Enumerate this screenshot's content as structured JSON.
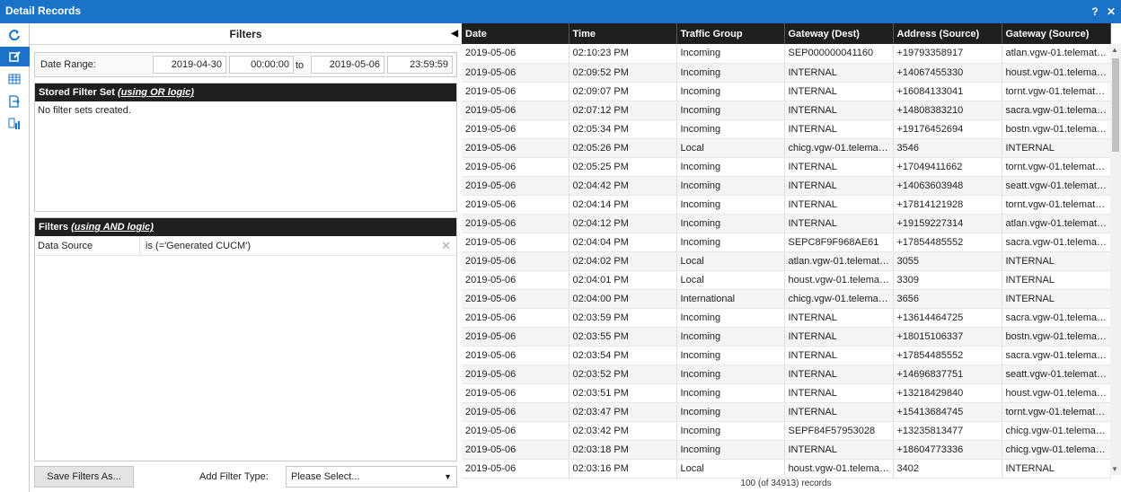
{
  "window": {
    "title": "Detail Records",
    "help": "?",
    "close": "✕"
  },
  "toolbar": {
    "icons": [
      "refresh-icon",
      "edit-icon",
      "table-icon",
      "export-icon",
      "report-icon"
    ]
  },
  "filters": {
    "title": "Filters",
    "date_range_label": "Date Range:",
    "start_date": "2019-04-30",
    "start_time": "00:00:00",
    "to_label": "to",
    "end_date": "2019-05-06",
    "end_time": "23:59:59",
    "stored_set_title": "Stored Filter Set",
    "stored_set_logic": "(using OR logic)",
    "stored_set_empty": "No filter sets created.",
    "filters_title": "Filters",
    "filters_logic": "(using AND logic)",
    "rows": [
      {
        "field": "Data Source",
        "condition": "is (='Generated CUCM')"
      }
    ],
    "save_button": "Save Filters As...",
    "add_filter_label": "Add Filter Type:",
    "add_filter_select": "Please Select..."
  },
  "grid": {
    "columns": [
      "Date",
      "Time",
      "Traffic Group",
      "Gateway (Dest)",
      "Address (Source)",
      "Gateway (Source)"
    ],
    "rows": [
      [
        "2019-05-06",
        "02:10:23 PM",
        "Incoming",
        "SEP000000041160",
        "+19793358917",
        "atlan.vgw-01.telemat…"
      ],
      [
        "2019-05-06",
        "02:09:52 PM",
        "Incoming",
        "INTERNAL",
        "+14067455330",
        "houst.vgw-01.telema…"
      ],
      [
        "2019-05-06",
        "02:09:07 PM",
        "Incoming",
        "INTERNAL",
        "+16084133041",
        "tornt.vgw-01.telemat…"
      ],
      [
        "2019-05-06",
        "02:07:12 PM",
        "Incoming",
        "INTERNAL",
        "+14808383210",
        "sacra.vgw-01.telema…"
      ],
      [
        "2019-05-06",
        "02:05:34 PM",
        "Incoming",
        "INTERNAL",
        "+19176452694",
        "bostn.vgw-01.telema…"
      ],
      [
        "2019-05-06",
        "02:05:26 PM",
        "Local",
        "chicg.vgw-01.telema…",
        "3546",
        "INTERNAL"
      ],
      [
        "2019-05-06",
        "02:05:25 PM",
        "Incoming",
        "INTERNAL",
        "+17049411662",
        "tornt.vgw-01.telemat…"
      ],
      [
        "2019-05-06",
        "02:04:42 PM",
        "Incoming",
        "INTERNAL",
        "+14063603948",
        "seatt.vgw-01.telemat…"
      ],
      [
        "2019-05-06",
        "02:04:14 PM",
        "Incoming",
        "INTERNAL",
        "+17814121928",
        "tornt.vgw-01.telemat…"
      ],
      [
        "2019-05-06",
        "02:04:12 PM",
        "Incoming",
        "INTERNAL",
        "+19159227314",
        "atlan.vgw-01.telemat…"
      ],
      [
        "2019-05-06",
        "02:04:04 PM",
        "Incoming",
        "SEPC8F9F968AE61",
        "+17854485552",
        "sacra.vgw-01.telema…"
      ],
      [
        "2019-05-06",
        "02:04:02 PM",
        "Local",
        "atlan.vgw-01.telemat…",
        "3055",
        "INTERNAL"
      ],
      [
        "2019-05-06",
        "02:04:01 PM",
        "Local",
        "houst.vgw-01.telema…",
        "3309",
        "INTERNAL"
      ],
      [
        "2019-05-06",
        "02:04:00 PM",
        "International",
        "chicg.vgw-01.telema…",
        "3656",
        "INTERNAL"
      ],
      [
        "2019-05-06",
        "02:03:59 PM",
        "Incoming",
        "INTERNAL",
        "+13614464725",
        "sacra.vgw-01.telema…"
      ],
      [
        "2019-05-06",
        "02:03:55 PM",
        "Incoming",
        "INTERNAL",
        "+18015106337",
        "bostn.vgw-01.telema…"
      ],
      [
        "2019-05-06",
        "02:03:54 PM",
        "Incoming",
        "INTERNAL",
        "+17854485552",
        "sacra.vgw-01.telema…"
      ],
      [
        "2019-05-06",
        "02:03:52 PM",
        "Incoming",
        "INTERNAL",
        "+14696837751",
        "seatt.vgw-01.telemat…"
      ],
      [
        "2019-05-06",
        "02:03:51 PM",
        "Incoming",
        "INTERNAL",
        "+13218429840",
        "houst.vgw-01.telema…"
      ],
      [
        "2019-05-06",
        "02:03:47 PM",
        "Incoming",
        "INTERNAL",
        "+15413684745",
        "tornt.vgw-01.telemat…"
      ],
      [
        "2019-05-06",
        "02:03:42 PM",
        "Incoming",
        "SEPF84F57953028",
        "+13235813477",
        "chicg.vgw-01.telema…"
      ],
      [
        "2019-05-06",
        "02:03:18 PM",
        "Incoming",
        "INTERNAL",
        "+18604773336",
        "chicg.vgw-01.telema…"
      ],
      [
        "2019-05-06",
        "02:03:16 PM",
        "Local",
        "houst.vgw-01.telema…",
        "3402",
        "INTERNAL"
      ]
    ],
    "footer": "100 (of 34913) records"
  }
}
